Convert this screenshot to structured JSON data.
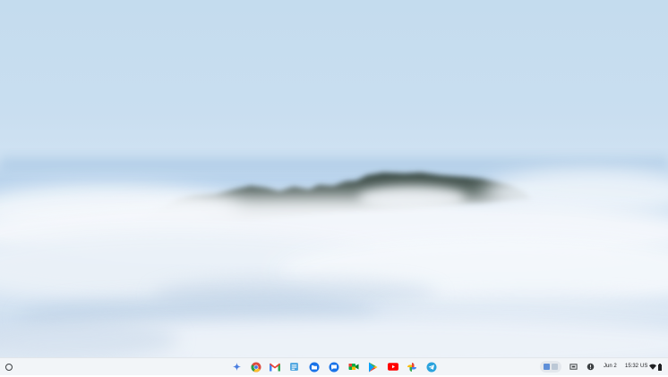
{
  "desktop": {
    "wallpaper": "mountain-peak-above-clouds",
    "sky_color": "#c9def0",
    "cloud_color": "#e3edf6",
    "mountain_color": "#4a5a55"
  },
  "shelf": {
    "background": "#f2f5f8",
    "launcher_icon": "launcher-circle-icon",
    "pinned_apps": [
      {
        "name": "gemini",
        "icon": "gemini-sparkle-icon"
      },
      {
        "name": "chrome",
        "icon": "chrome-icon"
      },
      {
        "name": "gmail",
        "icon": "gmail-icon"
      },
      {
        "name": "docs",
        "icon": "google-docs-icon"
      },
      {
        "name": "files",
        "icon": "files-icon"
      },
      {
        "name": "chat",
        "icon": "chat-icon"
      },
      {
        "name": "meet",
        "icon": "meet-icon"
      },
      {
        "name": "play-store",
        "icon": "play-store-icon"
      },
      {
        "name": "youtube",
        "icon": "youtube-icon"
      },
      {
        "name": "photos",
        "icon": "photos-icon"
      },
      {
        "name": "telegram",
        "icon": "telegram-icon"
      }
    ],
    "tray": {
      "holding_space_icon": "holding-space-icon",
      "capture_icon": "screen-capture-icon",
      "notification_icon": "notification-icon",
      "date": "Jun 2",
      "time": "15:32",
      "locale": "US",
      "wifi_icon": "wifi-icon",
      "battery_icon": "battery-icon"
    }
  }
}
